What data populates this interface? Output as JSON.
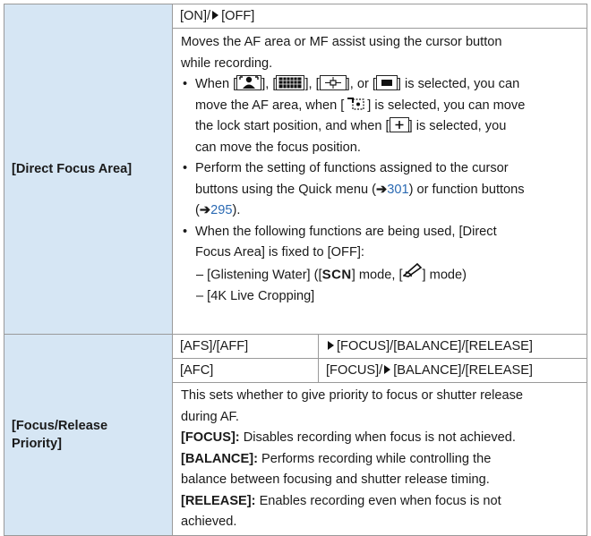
{
  "direct_focus_area": {
    "label": "[Direct Focus Area]",
    "options_text": "[ON]/",
    "options_selected": "[OFF]",
    "desc_line1": "Moves the AF area or MF assist using the cursor button",
    "desc_line2": "while recording.",
    "bullet1": {
      "t1": "When [",
      "t2": "], [",
      "t3": "], [",
      "t4": "], or [",
      "t5": "] is selected, you can",
      "line2a": "move the AF area, when [",
      "line2b": "] is selected, you can move",
      "line3a": "the lock start position, and when [",
      "line3b": "] is selected, you",
      "line4": "can move the focus position."
    },
    "bullet2": {
      "line1": "Perform the setting of functions assigned to the cursor",
      "line2a": "buttons using the Quick menu (",
      "ref1_arrow": "➔",
      "ref1": "301",
      "line2b": ") or function buttons",
      "line3a": "(",
      "ref2_arrow": "➔",
      "ref2": "295",
      "line3b": ")."
    },
    "bullet3": {
      "line1": "When the following functions are being used, [Direct",
      "line2": "Focus Area] is fixed to [OFF]:",
      "dash1a": "– [Glistening Water] ([",
      "scn": "SCN",
      "dash1b": "] mode, [",
      "dash1c": "] mode)",
      "dash2": "– [4K Live Cropping]"
    }
  },
  "focus_release_priority": {
    "label_line1": "[Focus/Release",
    "label_line2": "Priority]",
    "rows": [
      {
        "mode": "[AFS]/[AFF]",
        "value_pre": "",
        "value_sel": "[FOCUS]/[BALANCE]/[RELEASE]",
        "arrow_first": true
      },
      {
        "mode": "[AFC]",
        "value_pre": "[FOCUS]/",
        "value_sel": "[BALANCE]/[RELEASE]",
        "arrow_first": false
      }
    ],
    "desc_line1": "This sets whether to give priority to focus or shutter release",
    "desc_line2": "during AF.",
    "focus_term": "[FOCUS]:",
    "focus_text": " Disables recording when focus is not achieved.",
    "balance_term": "[BALANCE]:",
    "balance_text1": " Performs recording while controlling the",
    "balance_text2": "balance between focusing and shutter release timing.",
    "release_term": "[RELEASE]:",
    "release_text1": " Enables recording even when focus is not",
    "release_text2": "achieved."
  },
  "icons": [
    "face-eye-detection-icon",
    "tracking-icon",
    "225-area-icon",
    "zone-icon",
    "1-area-icon",
    "pinpoint-icon",
    "scn-mode-icon",
    "creative-control-icon"
  ]
}
